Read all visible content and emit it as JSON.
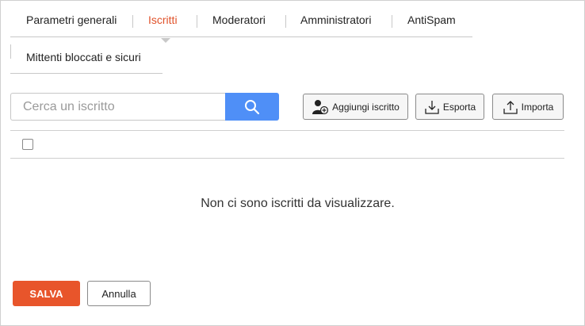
{
  "tabs": {
    "general": "Parametri generali",
    "subscribers": "Iscritti",
    "moderators": "Moderatori",
    "admins": "Amministratori",
    "antispam": "AntiSpam",
    "blocked": "Mittenti bloccati e sicuri",
    "active": "Iscritti",
    "active_color": "#e0522a"
  },
  "search": {
    "placeholder": "Cerca un iscritto",
    "value": ""
  },
  "toolbar": {
    "add_label": "Aggiungi iscritto",
    "export_label": "Esporta",
    "import_label": "Importa"
  },
  "table": {
    "empty_message": "Non ci sono iscritti da visualizzare."
  },
  "footer": {
    "save_label": "SALVA",
    "cancel_label": "Annulla"
  },
  "colors": {
    "accent": "#e8552b",
    "search_button": "#4f8ff7"
  }
}
